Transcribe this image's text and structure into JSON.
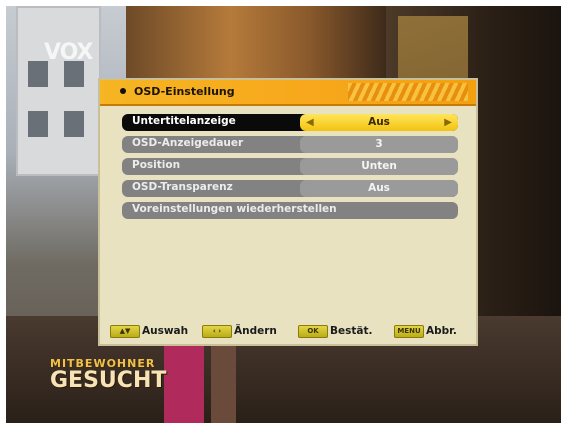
{
  "channel_logo": "VOX",
  "show_title": {
    "line1": "MITBEWOHNER",
    "line2": "GESUCHT"
  },
  "osd": {
    "title": "OSD-Einstellung",
    "rows": [
      {
        "label": "Untertitelanzeige",
        "value": "Aus",
        "selected": true
      },
      {
        "label": "OSD-Anzeigedauer",
        "value": "3",
        "selected": false
      },
      {
        "label": "Position",
        "value": "Unten",
        "selected": false
      },
      {
        "label": "OSD-Transparenz",
        "value": "Aus",
        "selected": false
      },
      {
        "label": "Voreinstellungen wiederherstellen",
        "value": "",
        "selected": false
      }
    ],
    "footer": [
      {
        "key": "",
        "label": "Auswah",
        "key_icon": "up-down-arrows-icon"
      },
      {
        "key": "‹ ›",
        "label": "Ändern",
        "key_icon": "left-right-arrows-icon"
      },
      {
        "key": "OK",
        "label": "Bestät.",
        "key_icon": "ok-key-icon"
      },
      {
        "key": "MENU",
        "label": "Abbr.",
        "key_icon": "menu-key-icon"
      }
    ]
  },
  "colors": {
    "header_orange": "#f7a81c",
    "selected_value_yellow": "#f3c310",
    "row_grey": "#828282",
    "panel_bg": "#e8e2c0"
  }
}
